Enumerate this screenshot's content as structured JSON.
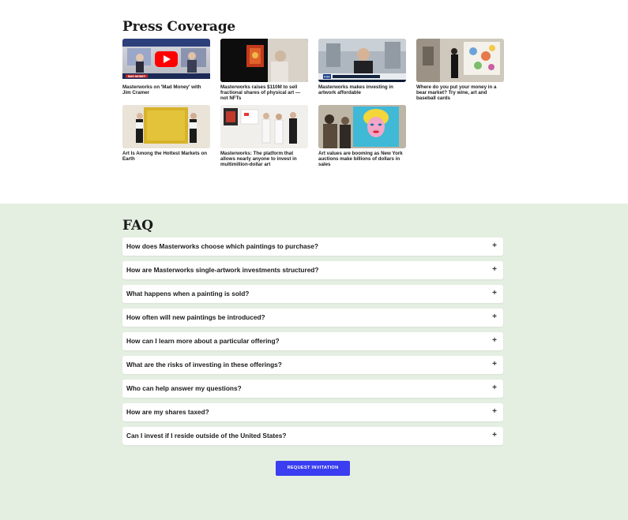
{
  "press": {
    "title": "Press Coverage",
    "articles": [
      {
        "caption": "Masterworks on 'Mad Money' with Jim Cramer",
        "thumb_label": "MAD MONEY"
      },
      {
        "caption": "Masterworks raises $110M to sell fractional shares of physical art — not NFTs"
      },
      {
        "caption": "Masterworks makes investing in artwork affordable",
        "thumb_label": "FOX"
      },
      {
        "caption": "Where do you put your money in a bear market? Try wine, art and baseball cards"
      },
      {
        "caption": "Art Is Among the Hottest Markets on Earth"
      },
      {
        "caption": "Masterworks: The platform that allows nearly anyone to invest in multimillion-dollar art"
      },
      {
        "caption": "Art values are booming as New York auctions make billions of dollars in sales"
      }
    ]
  },
  "faq": {
    "title": "FAQ",
    "questions": [
      "How does Masterworks choose which paintings to purchase?",
      "How are Masterworks single-artwork investments structured?",
      "What happens when a painting is sold?",
      "How often will new paintings be introduced?",
      "How can I learn more about a particular offering?",
      "What are the risks of investing in these offerings?",
      "Who can help answer my questions?",
      "How are my shares taxed?",
      "Can I invest if I reside outside of the United States?"
    ],
    "expand_symbol": "+",
    "cta_label": "REQUEST INVITATION"
  },
  "colors": {
    "faq_background": "#e4efe2",
    "cta_background": "#3b3df0",
    "play_button": "#ff0000"
  }
}
